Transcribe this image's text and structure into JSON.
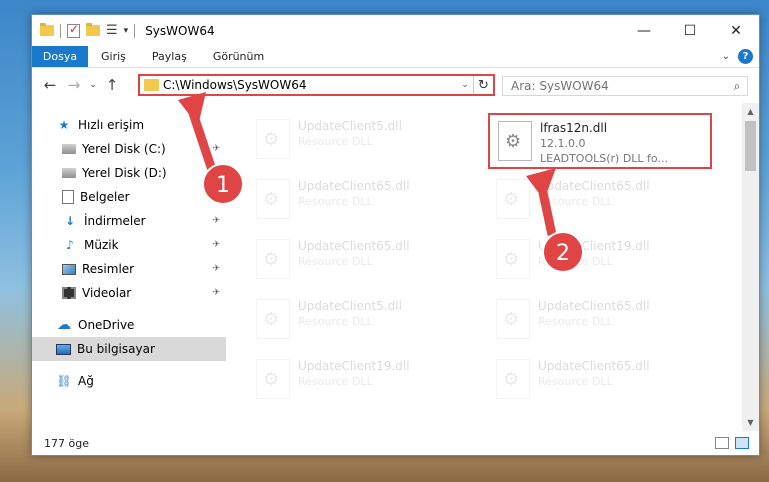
{
  "window": {
    "title": "SysWOW64",
    "controls": {
      "minimize": "—",
      "maximize": "☐",
      "close": "✕"
    }
  },
  "ribbon": {
    "file_tab": "Dosya",
    "tabs": [
      "Giriş",
      "Paylaş",
      "Görünüm"
    ],
    "collapse": "⌄",
    "help": "?"
  },
  "nav": {
    "back": "←",
    "forward": "→",
    "recent": "⌄",
    "up": "↑",
    "address": "C:\\Windows\\SysWOW64",
    "address_dropdown": "⌄",
    "refresh": "↻",
    "search_placeholder": "Ara: SysWOW64",
    "search_icon": "⌕"
  },
  "sidebar": {
    "items": [
      {
        "label": "Hızlı erişim",
        "icon": "star-icon"
      },
      {
        "label": "Yerel Disk (C:)",
        "icon": "drive-icon",
        "pin": "✈"
      },
      {
        "label": "Yerel Disk (D:)",
        "icon": "drive-icon"
      },
      {
        "label": "Belgeler",
        "icon": "document-icon"
      },
      {
        "label": "İndirmeler",
        "icon": "download-icon",
        "pin": "✈"
      },
      {
        "label": "Müzik",
        "icon": "music-icon",
        "pin": "✈"
      },
      {
        "label": "Resimler",
        "icon": "pictures-icon",
        "pin": "✈"
      },
      {
        "label": "Videolar",
        "icon": "video-icon",
        "pin": "✈"
      },
      {
        "label": "OneDrive",
        "icon": "cloud-icon"
      },
      {
        "label": "Bu bilgisayar",
        "icon": "computer-icon"
      },
      {
        "label": "Ağ",
        "icon": "network-icon"
      }
    ]
  },
  "files": {
    "highlighted": {
      "name": "lfras12n.dll",
      "version": "12.1.0.0",
      "description": "LEADTOOLS(r) DLL fo..."
    },
    "left_column": [
      {
        "name": "UpdateClient5.dll",
        "type": "Resource DLL"
      },
      {
        "name": "UpdateClient65.dll",
        "type": "Resource DLL"
      },
      {
        "name": "UpdateClient65.dll",
        "type": "Resource DLL"
      },
      {
        "name": "UpdateClient5.dll",
        "type": "Resource DLL"
      },
      {
        "name": "UpdateClient19.dll",
        "type": "Resource DLL"
      }
    ],
    "right_column": [
      {
        "name": "UpdateClient65.dll",
        "type": "Resource DLL"
      },
      {
        "name": "UpdateClient19.dll",
        "type": "Resource DLL"
      },
      {
        "name": "UpdateClient65.dll",
        "type": "Resource DLL"
      },
      {
        "name": "UpdateClient65.dll",
        "type": "Resource DLL"
      }
    ]
  },
  "status": {
    "count": "177 öge"
  },
  "annotations": {
    "step1": "1",
    "step2": "2",
    "color": "#e04545"
  }
}
